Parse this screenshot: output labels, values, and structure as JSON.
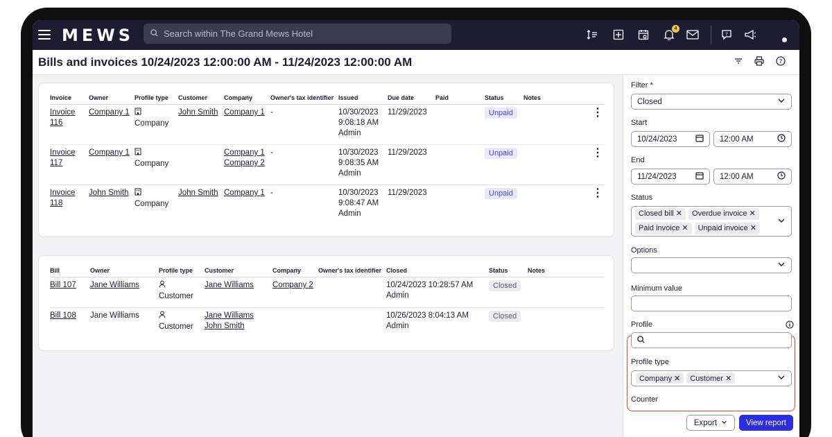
{
  "app": {
    "logo": "MEWS"
  },
  "search": {
    "placeholder": "Search within The Grand Mews Hotel"
  },
  "topbar": {
    "notification_count": "4"
  },
  "page": {
    "title": "Bills and invoices 10/24/2023 12:00:00 AM - 11/24/2023 12:00:00 AM"
  },
  "invoices": {
    "headers": [
      "Invoice",
      "Owner",
      "Profile type",
      "Customer",
      "Company",
      "Owner's tax identifier",
      "Issued",
      "Due date",
      "Paid",
      "Status",
      "Notes"
    ],
    "rows": [
      {
        "invoice": "Invoice 116",
        "owner": "Company 1",
        "profile_type": "Company",
        "customer": "John Smith",
        "company": [
          "Company 1"
        ],
        "tax": "-",
        "issued_date": "10/30/2023",
        "issued_time": "9:08:18 AM",
        "issued_by": "Admin",
        "due": "11/29/2023",
        "paid": "",
        "status": "Unpaid",
        "notes": ""
      },
      {
        "invoice": "Invoice 117",
        "owner": "Company 1",
        "profile_type": "Company",
        "customer": "",
        "company": [
          "Company 1",
          "Company 2"
        ],
        "tax": "-",
        "issued_date": "10/30/2023",
        "issued_time": "9:08:35 AM",
        "issued_by": "Admin",
        "due": "11/29/2023",
        "paid": "",
        "status": "Unpaid",
        "notes": ""
      },
      {
        "invoice": "Invoice 118",
        "owner": "John Smith",
        "profile_type": "Company",
        "customer": "John Smith",
        "company": [
          "Company 1"
        ],
        "tax": "-",
        "issued_date": "10/30/2023",
        "issued_time": "9:08:47 AM",
        "issued_by": "Admin",
        "due": "11/29/2023",
        "paid": "",
        "status": "Unpaid",
        "notes": ""
      }
    ]
  },
  "bills": {
    "headers": [
      "Bill",
      "Owner",
      "Profile type",
      "Customer",
      "Company",
      "Owner's tax identifier",
      "Closed",
      "Status",
      "Notes"
    ],
    "rows": [
      {
        "bill": "Bill 107",
        "owner": "Jane Williams",
        "owner_link": true,
        "profile_type": "Customer",
        "customer": [
          "Jane Williams"
        ],
        "company": "Company 2",
        "tax": "",
        "closed": "10/24/2023 10:28:57 AM",
        "closed_by": "Admin",
        "status": "Closed",
        "notes": ""
      },
      {
        "bill": "Bill 108",
        "owner": "Jane Williams",
        "owner_link": false,
        "profile_type": "Customer",
        "customer": [
          "Jane Williams",
          "John Smith"
        ],
        "company": "",
        "tax": "",
        "closed": "10/26/2023 8:04:13 AM",
        "closed_by": "Admin",
        "status": "Closed",
        "notes": ""
      }
    ]
  },
  "filters": {
    "filter_label": "Filter *",
    "filter_value": "Closed",
    "start_label": "Start",
    "start_date": "10/24/2023",
    "start_time": "12:00 AM",
    "end_label": "End",
    "end_date": "11/24/2023",
    "end_time": "12:00 AM",
    "status_label": "Status",
    "status_chips": [
      "Closed bill",
      "Overdue invoice",
      "Paid invoice",
      "Unpaid invoice"
    ],
    "options_label": "Options",
    "options_value": "",
    "min_value_label": "Minimum value",
    "min_value": "",
    "profile_label": "Profile",
    "profile_value": "",
    "profile_type_label": "Profile type",
    "profile_type_chips": [
      "Company",
      "Customer"
    ],
    "counter_label": "Counter",
    "export_label": "Export",
    "view_report_label": "View report"
  },
  "colors": {
    "topbar": "#1c1d33",
    "primary": "#2b2de0",
    "highlight": "#e0452c",
    "unpaid_pill": "#e8e8fb"
  }
}
